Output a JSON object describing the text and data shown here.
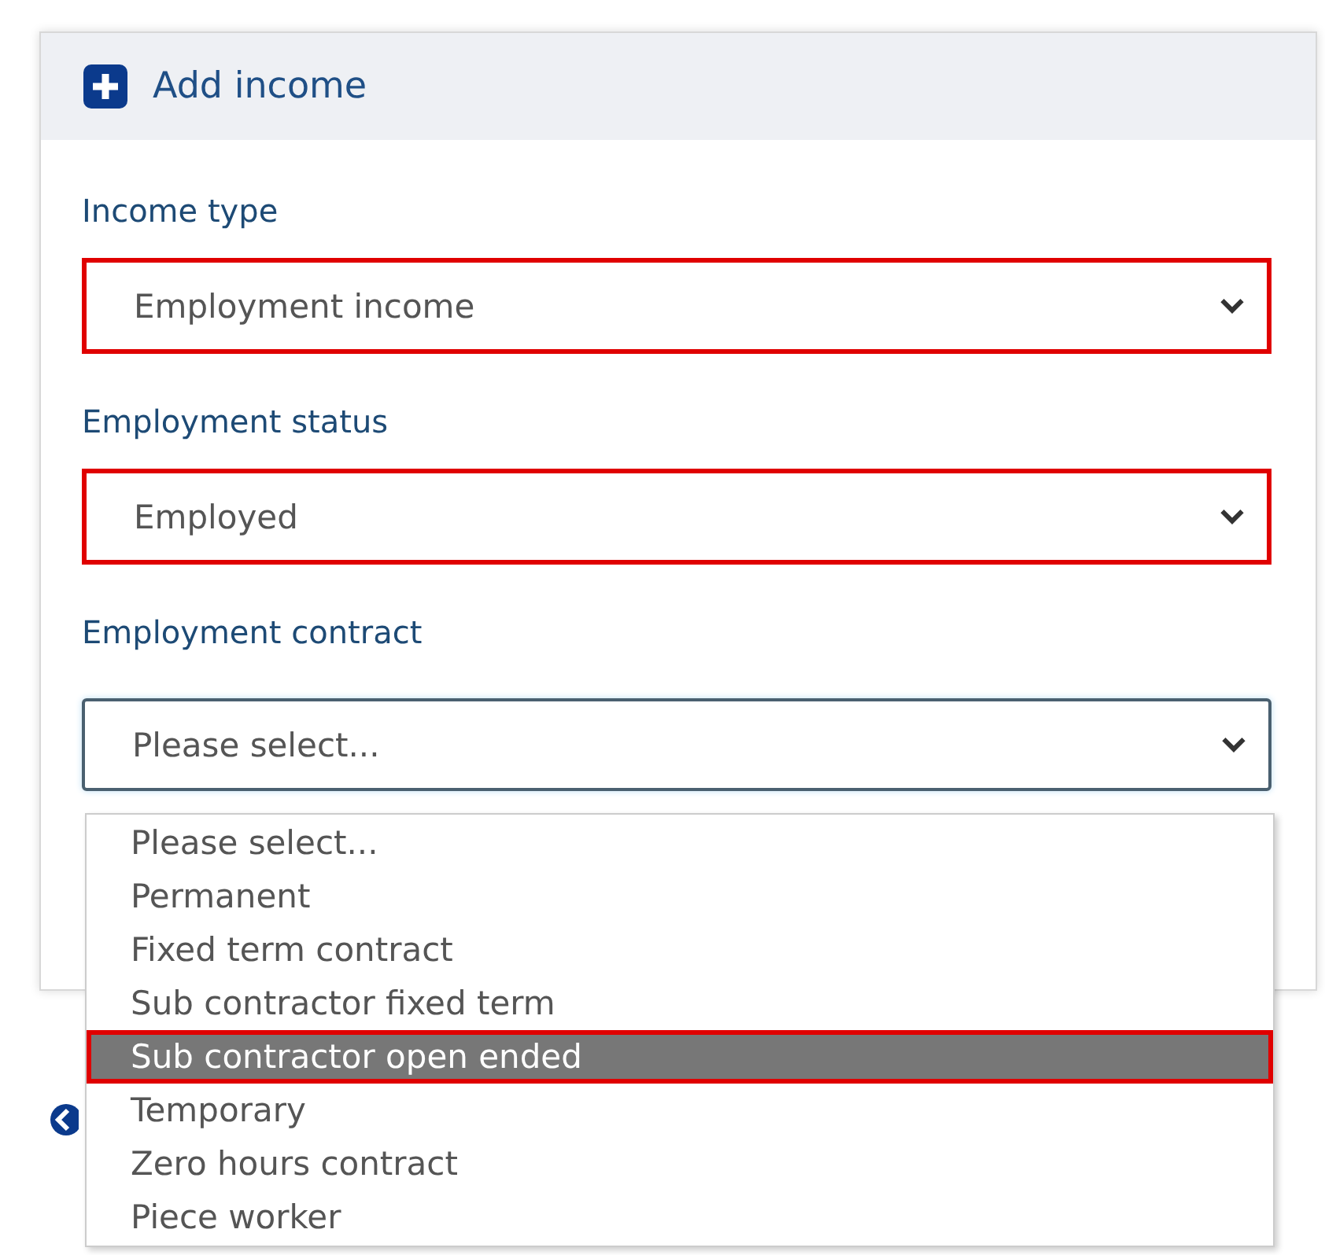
{
  "panel": {
    "title": "Add income"
  },
  "fields": [
    {
      "label": "Income type",
      "value": "Employment income",
      "outlined": true,
      "focused": false
    },
    {
      "label": "Employment status",
      "value": "Employed",
      "outlined": true,
      "focused": false
    },
    {
      "label": "Employment contract",
      "value": "Please select...",
      "outlined": false,
      "focused": true
    }
  ],
  "dropdown": {
    "options": [
      {
        "label": "Please select...",
        "selected": false,
        "outlined": false
      },
      {
        "label": "Permanent",
        "selected": false,
        "outlined": false
      },
      {
        "label": "Fixed term contract",
        "selected": false,
        "outlined": false
      },
      {
        "label": "Sub contractor fixed term",
        "selected": false,
        "outlined": false
      },
      {
        "label": "Sub contractor open ended",
        "selected": true,
        "outlined": true
      },
      {
        "label": "Temporary",
        "selected": false,
        "outlined": false
      },
      {
        "label": "Zero hours contract",
        "selected": false,
        "outlined": false
      },
      {
        "label": "Piece worker",
        "selected": false,
        "outlined": false
      }
    ]
  }
}
